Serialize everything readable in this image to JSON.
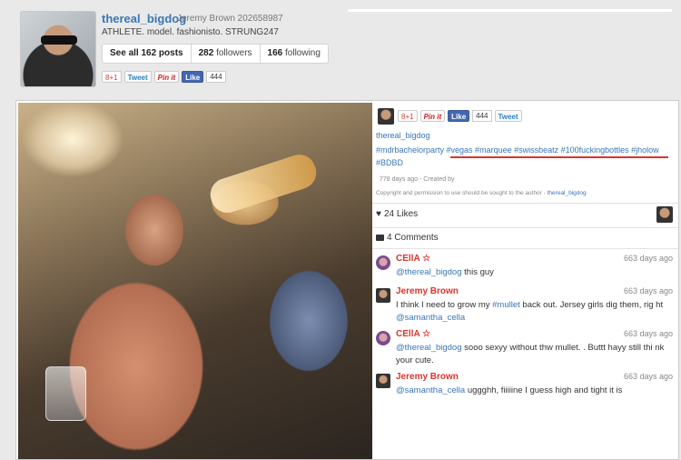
{
  "profile": {
    "username": "thereal_bigdog",
    "fullname": "Jeremy Brown 202658987",
    "bio": "ATHLETE. model. fashionisto. STRUNG247",
    "stats": {
      "posts": {
        "prefix": "See all ",
        "num": "162",
        "suffix": " posts"
      },
      "followers": {
        "num": "282",
        "suffix": " followers"
      },
      "following": {
        "num": "166",
        "suffix": " following"
      }
    },
    "share": {
      "gplus": "8+1",
      "tweet": "Tweet",
      "pin": "Pin it",
      "like": "Like",
      "like_count": "444"
    }
  },
  "post": {
    "share": {
      "gplus": "8+1",
      "pin": "Pin it",
      "like": "Like",
      "like_count": "444",
      "tweet": "Tweet"
    },
    "username": "thereal_bigdog",
    "tags": "#mdrbachelorparty #vegas #marquee #swissbeatz #100fuckingbottles #jholow #BDBD",
    "meta": "778 days ago - Created by",
    "copyright_prefix": "Copyright and permission to use should be sought to the author - ",
    "copyright_user": "thereal_bigdog",
    "likes": "24 Likes",
    "comments_count": "4 Comments",
    "comments": [
      {
        "name": "CEllA ☆",
        "time": "663 days ago",
        "mention": "@thereal_bigdog",
        "text": " this guy"
      },
      {
        "name": "Jeremy Brown",
        "time": "663 days ago",
        "text_a": "I think I need to grow my ",
        "link": "#mullet",
        "text_b": " back out. Jersey girls dig them, rig ht ",
        "mention": "@samantha_cella"
      },
      {
        "name": "CEllA ☆",
        "time": "663 days ago",
        "mention": "@thereal_bigdog",
        "text": " sooo sexyy without thw mullet. . Buttt hayy still thi nk your cute."
      },
      {
        "name": "Jeremy Brown",
        "time": "663 days ago",
        "mention": "@samantha_cella",
        "text": " uggghh, fiiiiine I guess high and tight it is"
      }
    ]
  }
}
